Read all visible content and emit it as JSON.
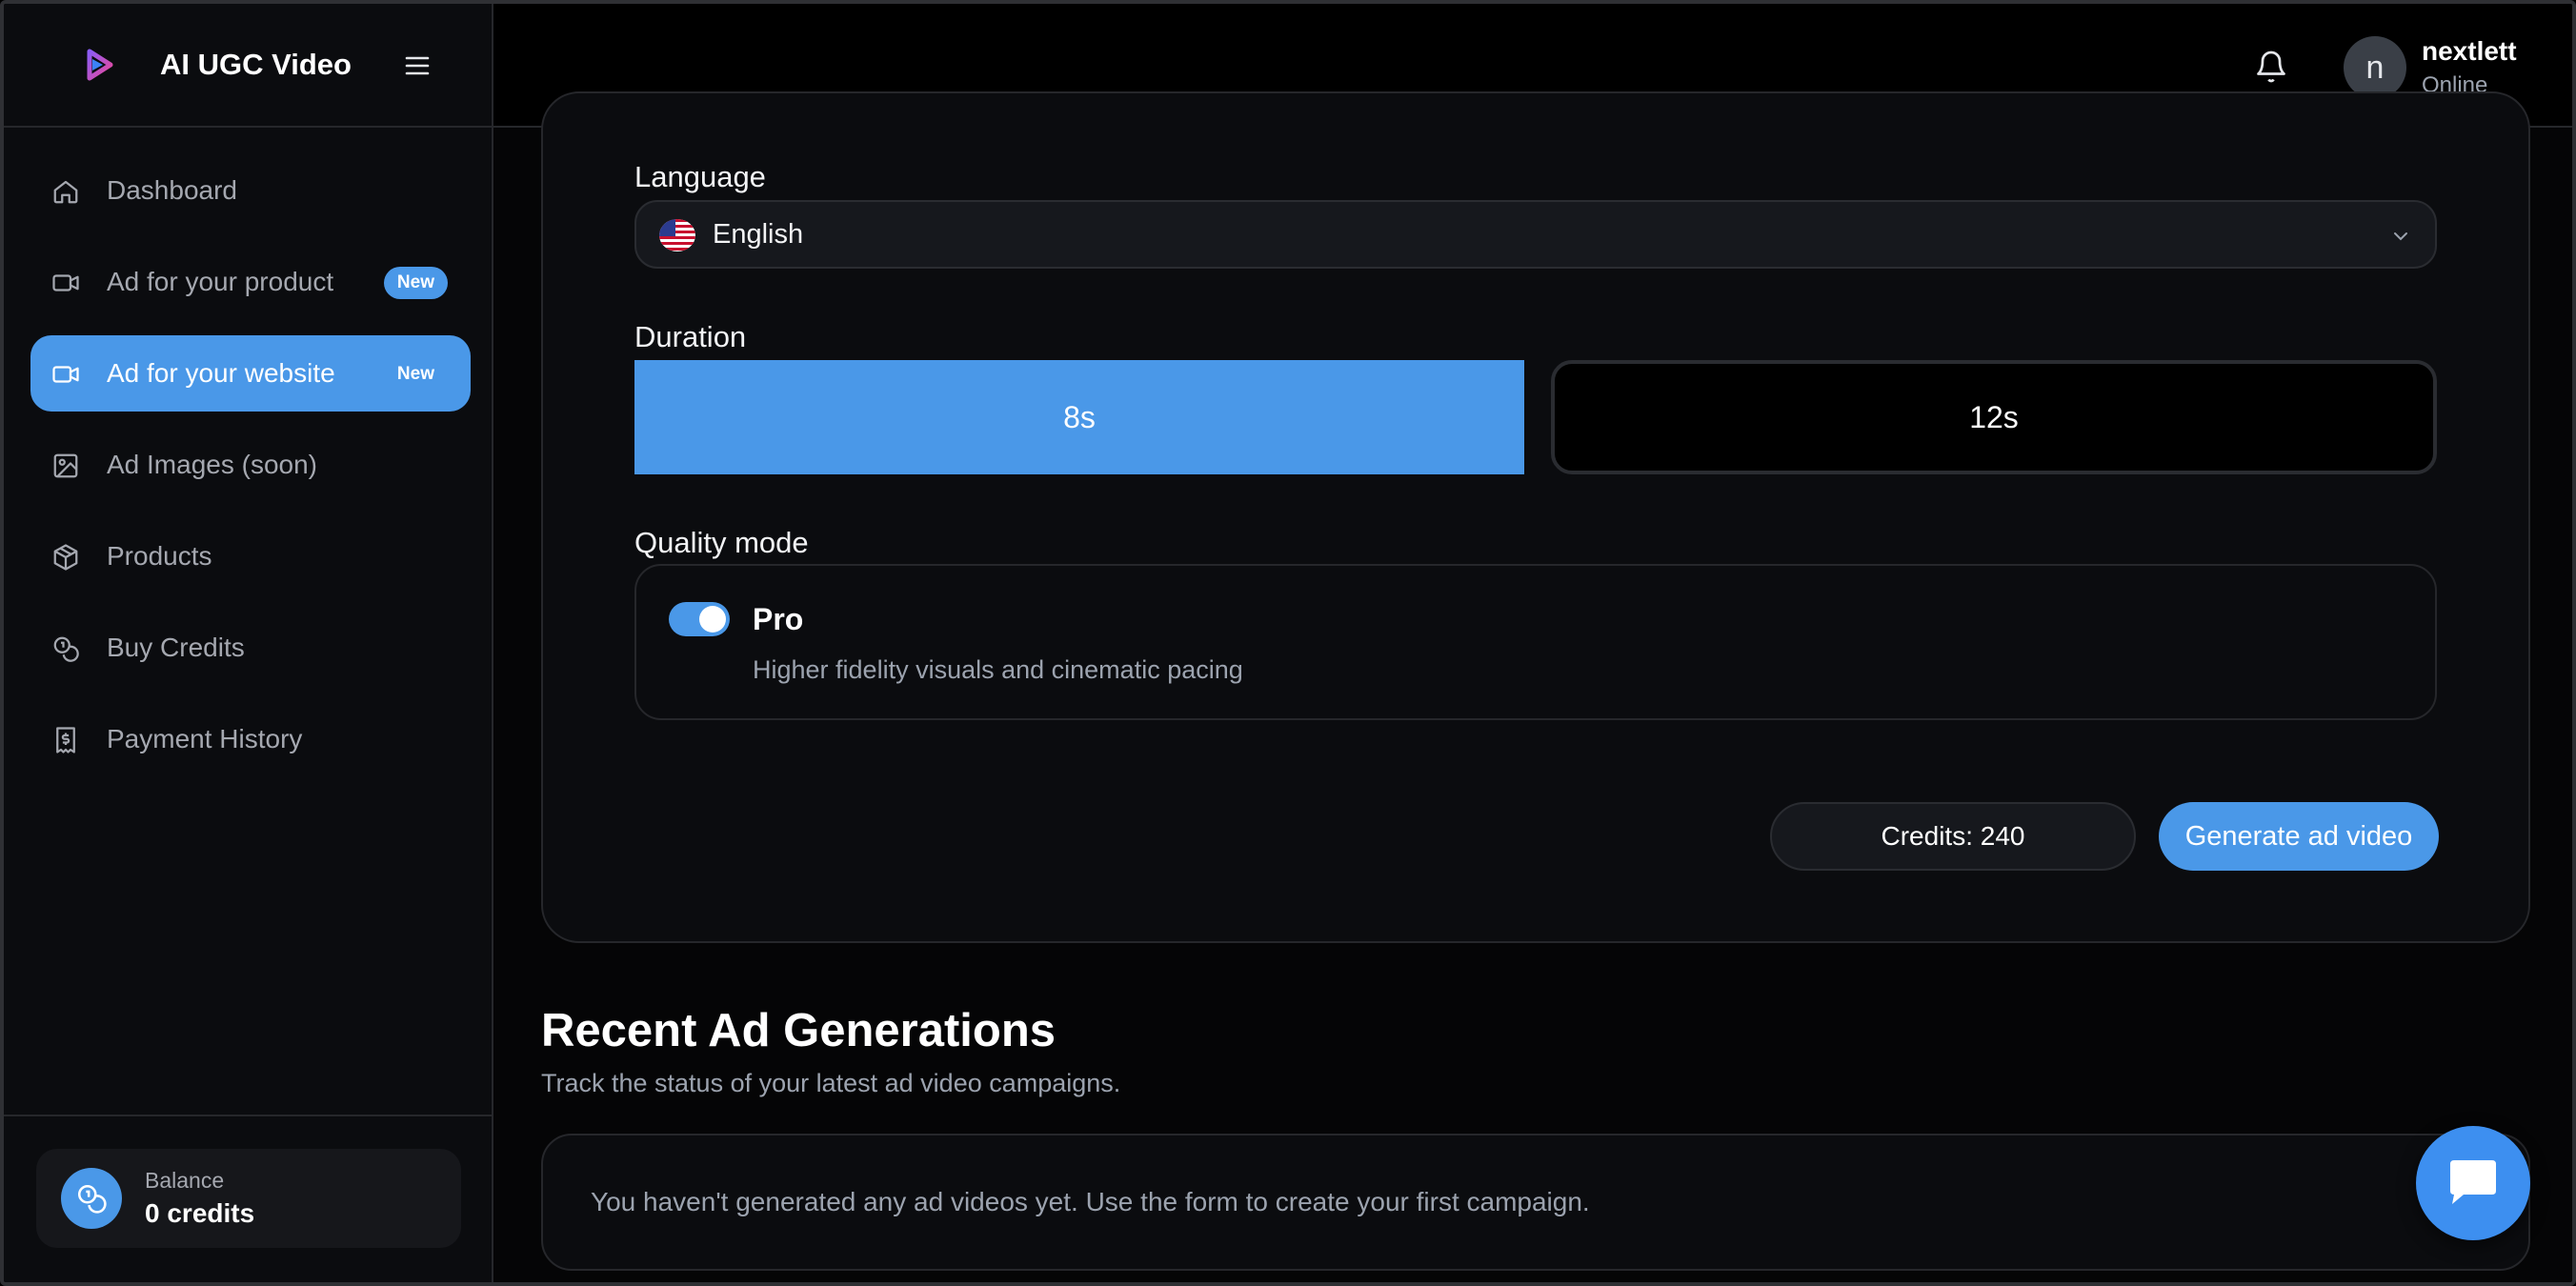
{
  "app": {
    "title": "AI UGC Video"
  },
  "sidebar": {
    "items": [
      {
        "label": "Dashboard",
        "icon": "home-icon",
        "active": false,
        "badge": ""
      },
      {
        "label": "Ad for your product",
        "icon": "video-camera-icon",
        "active": false,
        "badge": "New"
      },
      {
        "label": "Ad for your website",
        "icon": "video-camera-icon",
        "active": true,
        "badge": "New"
      },
      {
        "label": "Ad Images (soon)",
        "icon": "image-icon",
        "active": false,
        "badge": ""
      },
      {
        "label": "Products",
        "icon": "box-icon",
        "active": false,
        "badge": ""
      },
      {
        "label": "Buy Credits",
        "icon": "coins-icon",
        "active": false,
        "badge": ""
      },
      {
        "label": "Payment History",
        "icon": "receipt-icon",
        "active": false,
        "badge": ""
      }
    ],
    "balance": {
      "label": "Balance",
      "value": "0 credits"
    }
  },
  "header": {
    "user": {
      "initial": "n",
      "name": "nextlett",
      "status": "Online"
    }
  },
  "form": {
    "language": {
      "label": "Language",
      "value": "English",
      "flag": "us-flag-icon"
    },
    "duration": {
      "label": "Duration",
      "options": [
        "8s",
        "12s"
      ],
      "selected": "8s"
    },
    "quality": {
      "label": "Quality mode",
      "title": "Pro",
      "description": "Higher fidelity visuals and cinematic pacing",
      "enabled": true
    },
    "credits": "Credits: 240",
    "generate_label": "Generate ad video"
  },
  "recent": {
    "title": "Recent Ad Generations",
    "subtitle": "Track the status of your latest ad video campaigns.",
    "empty": "You haven't generated any ad videos yet. Use the form to create your first campaign."
  },
  "colors": {
    "accent": "#4a98e8",
    "background": "#050506",
    "panel": "#0b0c0f"
  }
}
